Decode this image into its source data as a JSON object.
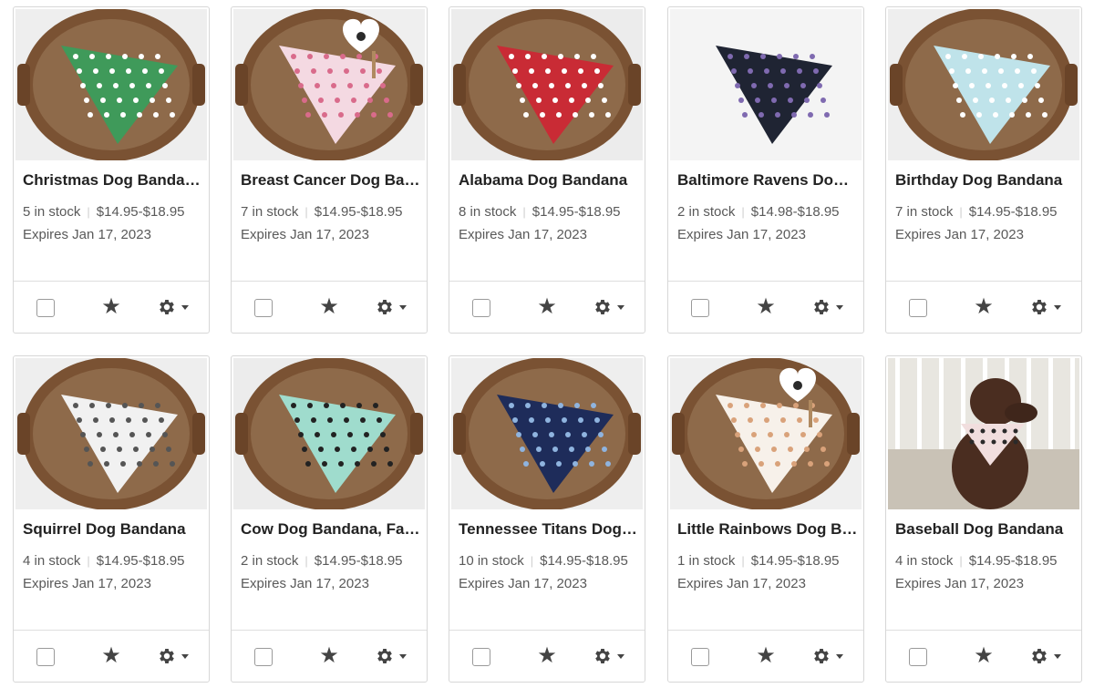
{
  "colors": {
    "text_primary": "#222222",
    "text_secondary": "#595959",
    "border": "#d7d7d7",
    "icon": "#444444"
  },
  "listings": [
    {
      "title": "Christmas Dog Bandana, Over the Collar",
      "stock": "5 in stock",
      "price": "$14.95-$18.95",
      "expires": "Expires Jan 17, 2023",
      "image": "green christmas bandana on wooden tray"
    },
    {
      "title": "Breast Cancer Dog Bandana",
      "stock": "7 in stock",
      "price": "$14.95-$18.95",
      "expires": "Expires Jan 17, 2023",
      "image": "pink bandana with paw heart tag on wooden tray"
    },
    {
      "title": "Alabama Dog Bandana",
      "stock": "8 in stock",
      "price": "$14.95-$18.95",
      "expires": "Expires Jan 17, 2023",
      "image": "red alabama bandana on wooden tray"
    },
    {
      "title": "Baltimore Ravens Dog Bandana",
      "stock": "2 in stock",
      "price": "$14.98-$18.95",
      "expires": "Expires Jan 17, 2023",
      "image": "black ravens bandana on white background"
    },
    {
      "title": "Birthday Dog Bandana",
      "stock": "7 in stock",
      "price": "$14.95-$18.95",
      "expires": "Expires Jan 17, 2023",
      "image": "light blue bandana on wooden tray"
    },
    {
      "title": "Squirrel Dog Bandana",
      "stock": "4 in stock",
      "price": "$14.95-$18.95",
      "expires": "Expires Jan 17, 2023",
      "image": "white squirrel print bandana on wooden tray"
    },
    {
      "title": "Cow Dog Bandana, Farm",
      "stock": "2 in stock",
      "price": "$14.95-$18.95",
      "expires": "Expires Jan 17, 2023",
      "image": "mint cow print bandana on wooden tray"
    },
    {
      "title": "Tennessee Titans Dog Bandana",
      "stock": "10 in stock",
      "price": "$14.95-$18.95",
      "expires": "Expires Jan 17, 2023",
      "image": "navy titans bandana on wooden tray"
    },
    {
      "title": "Little Rainbows Dog Bandana",
      "stock": "1 in stock",
      "price": "$14.95-$18.95",
      "expires": "Expires Jan 17, 2023",
      "image": "rainbow print bandana with paw heart tag on wooden tray"
    },
    {
      "title": "Baseball Dog Bandana",
      "stock": "4 in stock",
      "price": "$14.95-$18.95",
      "expires": "Expires Jan 17, 2023",
      "image": "brown labrador wearing bandana on porch"
    }
  ],
  "actions": {
    "select_icon": "checkbox",
    "feature_icon": "star-icon",
    "settings_icon": "gear-icon"
  }
}
